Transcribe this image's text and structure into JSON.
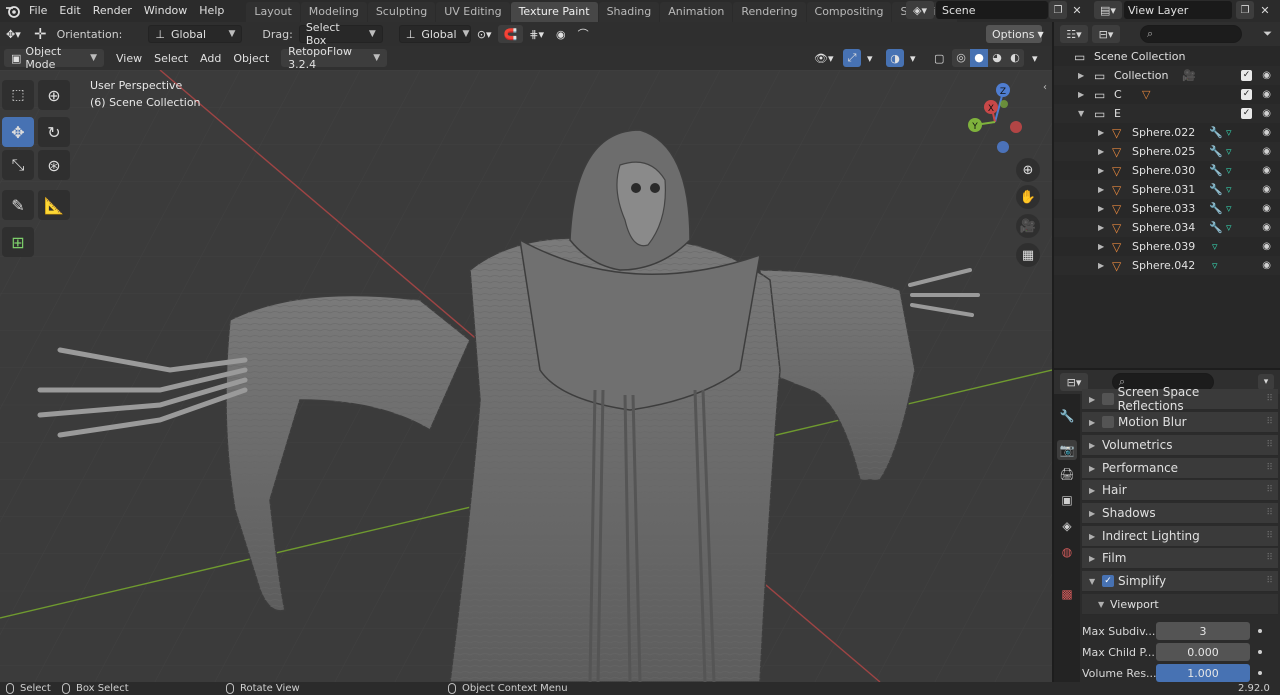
{
  "menu": {
    "items": [
      "File",
      "Edit",
      "Render",
      "Window",
      "Help"
    ],
    "workspaces": [
      "Layout",
      "Modeling",
      "Sculpting",
      "UV Editing",
      "Texture Paint",
      "Shading",
      "Animation",
      "Rendering",
      "Compositing",
      "Scripting"
    ],
    "active_workspace": "Texture Paint",
    "add_tab": "+",
    "scene_name": "Scene",
    "view_layer": "View Layer"
  },
  "viewport": {
    "orientation_label": "Orientation:",
    "orientation_value": "Global",
    "drag_label": "Drag:",
    "drag_value": "Select Box",
    "transform_value": "Global",
    "options_label": "Options",
    "mode": "Object Mode",
    "menu_view": "View",
    "menu_select": "Select",
    "menu_add": "Add",
    "menu_object": "Object",
    "addon": "RetopoFlow 3.2.4",
    "perspective": "User Perspective",
    "collection_info": "(6) Scene Collection",
    "gizmo": {
      "x": "X",
      "y": "Y",
      "z": "Z"
    }
  },
  "outliner": {
    "search_placeholder": "",
    "root": "Scene Collection",
    "rows": [
      {
        "label": "Collection",
        "kind": "collection",
        "depth": 1,
        "expanded": false
      },
      {
        "label": "C",
        "kind": "collection",
        "depth": 1,
        "expanded": false
      },
      {
        "label": "E",
        "kind": "collection",
        "depth": 1,
        "expanded": true
      },
      {
        "label": "Sphere.022",
        "kind": "mesh",
        "depth": 2
      },
      {
        "label": "Sphere.025",
        "kind": "mesh",
        "depth": 2
      },
      {
        "label": "Sphere.030",
        "kind": "mesh",
        "depth": 2
      },
      {
        "label": "Sphere.031",
        "kind": "mesh",
        "depth": 2
      },
      {
        "label": "Sphere.033",
        "kind": "mesh",
        "depth": 2
      },
      {
        "label": "Sphere.034",
        "kind": "mesh",
        "depth": 2
      },
      {
        "label": "Sphere.039",
        "kind": "mesh",
        "depth": 2
      },
      {
        "label": "Sphere.042",
        "kind": "mesh",
        "depth": 2
      }
    ]
  },
  "properties": {
    "search_placeholder": "",
    "panels": [
      {
        "label": "Screen Space Reflections",
        "checkbox": true,
        "checked": false
      },
      {
        "label": "Motion Blur",
        "checkbox": true,
        "checked": false
      },
      {
        "label": "Volumetrics",
        "checkbox": false
      },
      {
        "label": "Performance",
        "checkbox": false
      },
      {
        "label": "Hair",
        "checkbox": false
      },
      {
        "label": "Shadows",
        "checkbox": false
      },
      {
        "label": "Indirect Lighting",
        "checkbox": false
      },
      {
        "label": "Film",
        "checkbox": false
      },
      {
        "label": "Simplify",
        "checkbox": true,
        "checked": true,
        "expanded": true
      }
    ],
    "subpanel": "Viewport",
    "fields": [
      {
        "label": "Max Subdiv...",
        "value": "3"
      },
      {
        "label": "Max Child P...",
        "value": "0.000"
      },
      {
        "label": "Volume Res...",
        "value": "1.000"
      }
    ]
  },
  "statusbar": {
    "select": "Select",
    "box_select": "Box Select",
    "rotate_view": "Rotate View",
    "context_menu": "Object Context Menu",
    "version": "2.92.0"
  },
  "colors": {
    "accent_blue": "#4772b3",
    "mesh_orange": "#e5873e",
    "axis_red": "#b04848",
    "axis_green": "#6f9a2f"
  }
}
